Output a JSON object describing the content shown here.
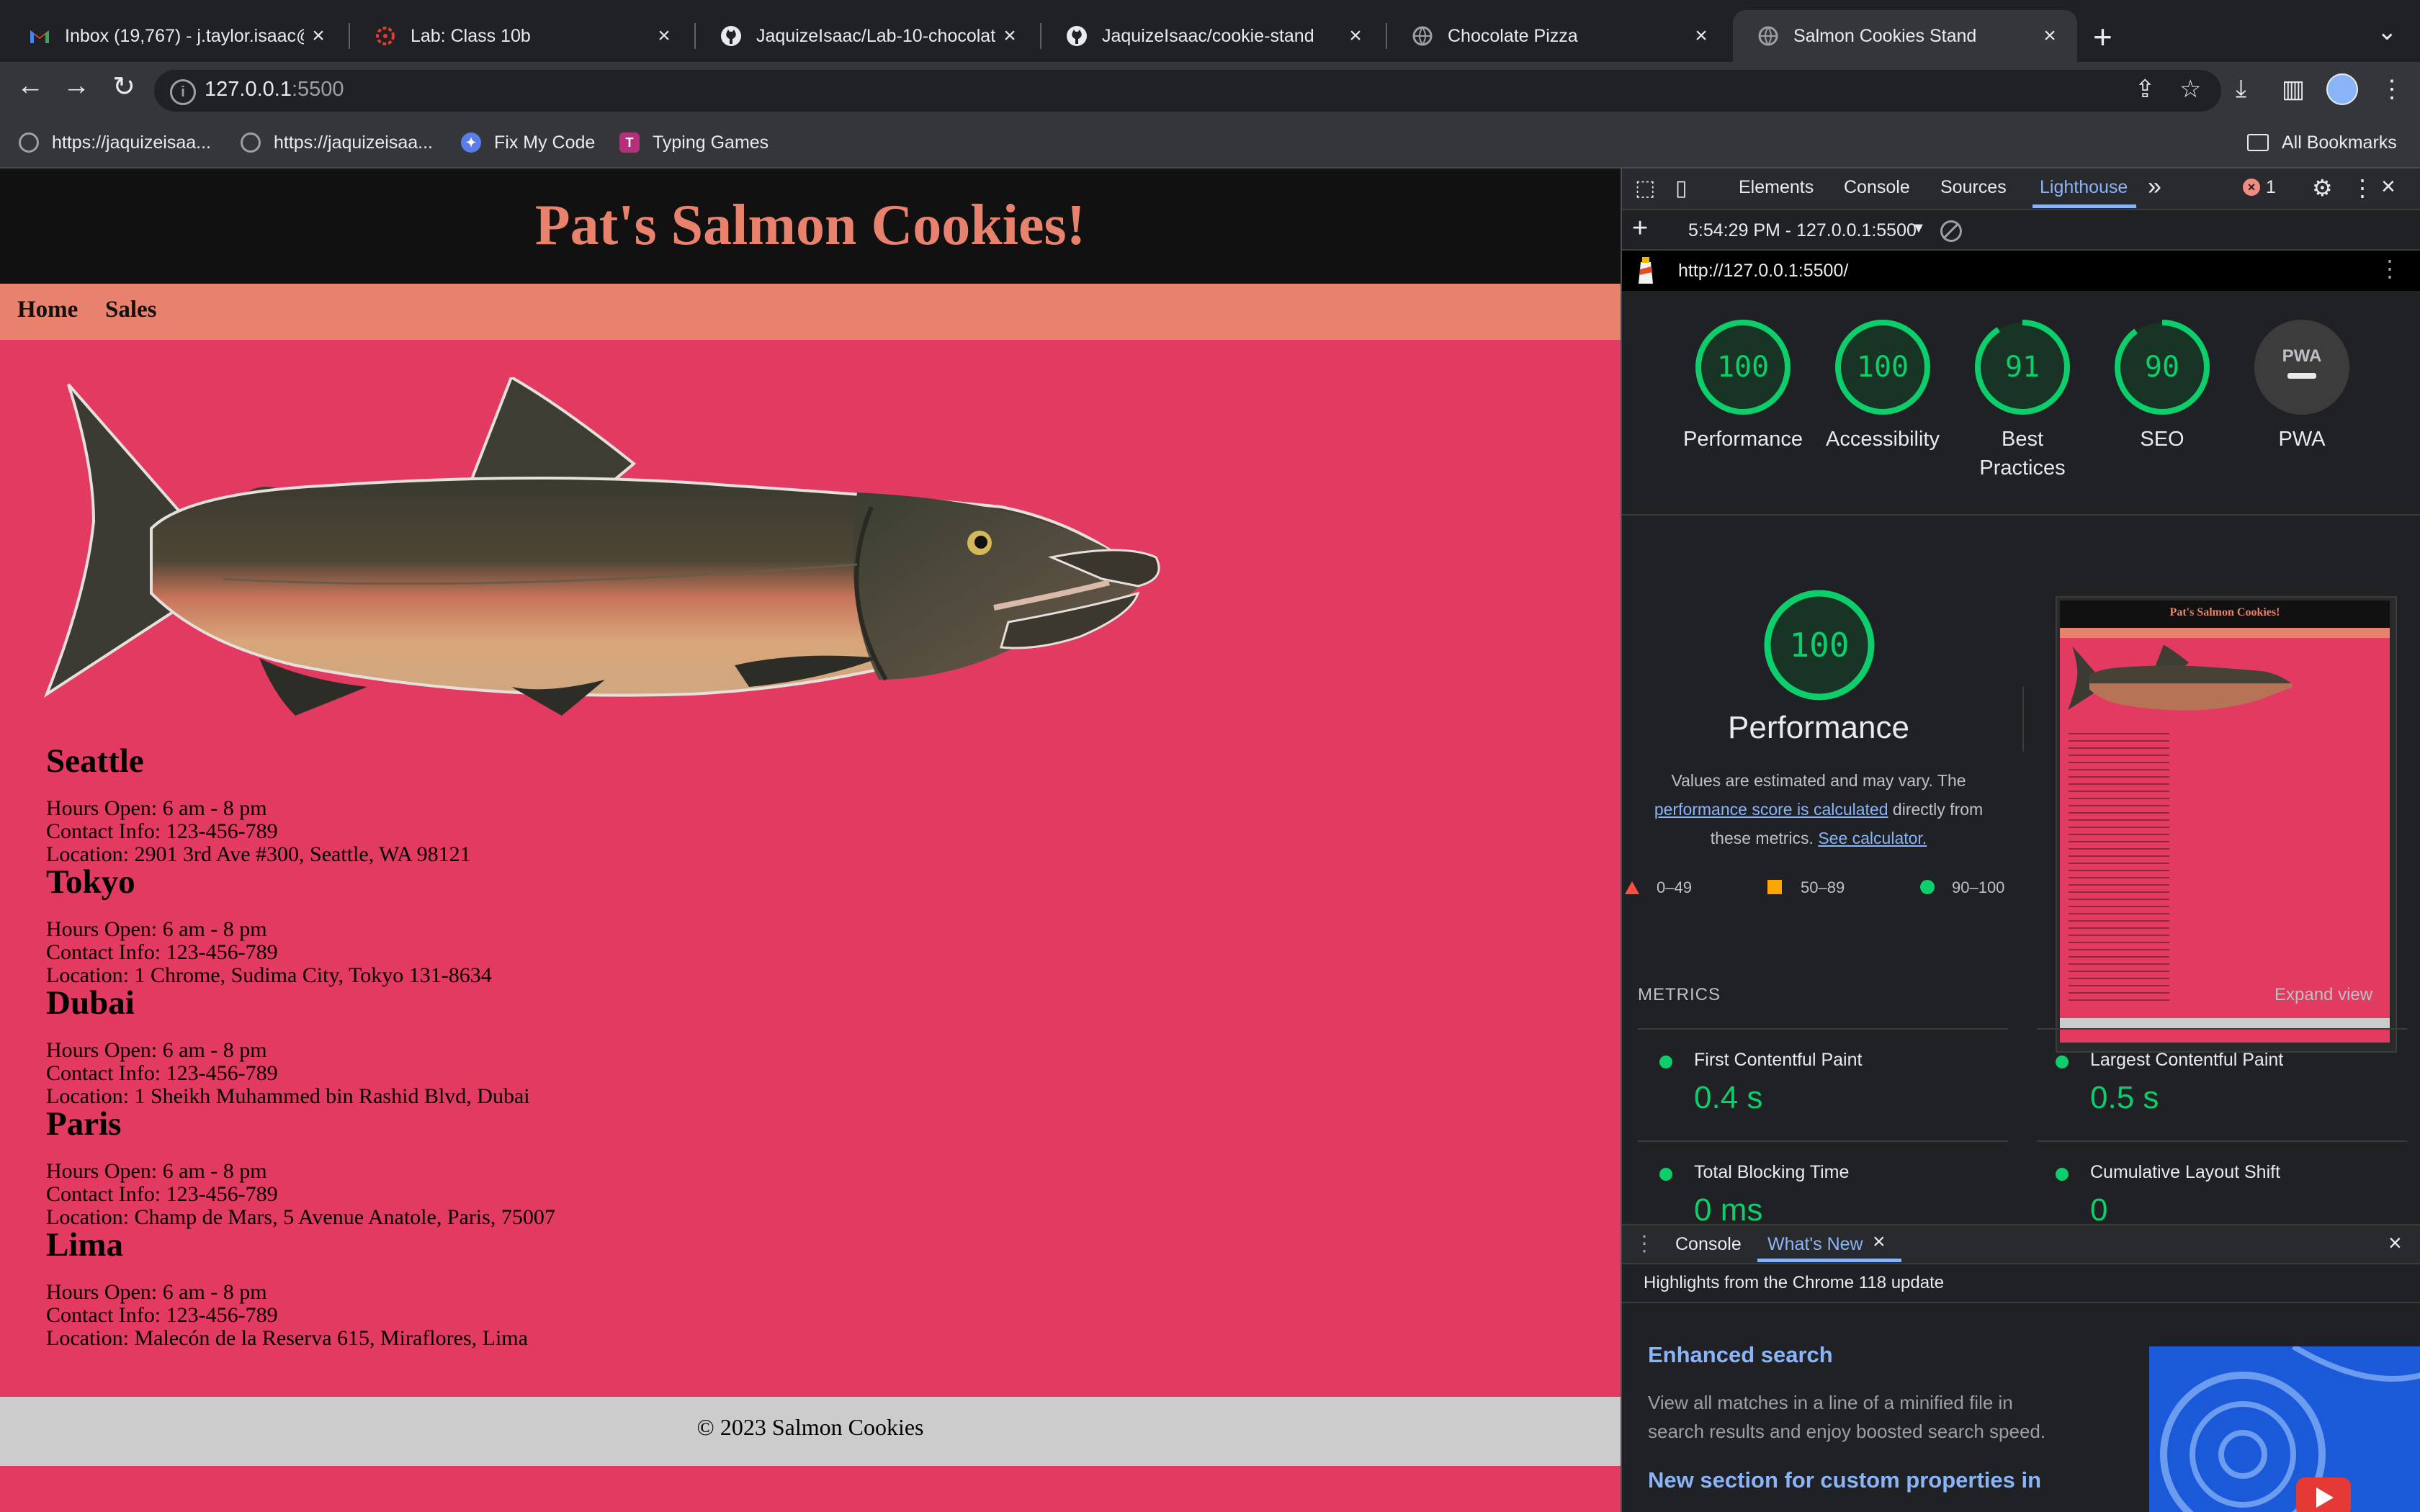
{
  "browser": {
    "tabs": [
      {
        "title": "Inbox (19,767) - j.taylor.isaac@",
        "icon": "gmail-icon",
        "active": false
      },
      {
        "title": "Lab: Class 10b",
        "icon": "canvas-icon",
        "active": false
      },
      {
        "title": "JaquizeIsaac/Lab-10-chocolat",
        "icon": "github-icon",
        "active": false
      },
      {
        "title": "JaquizeIsaac/cookie-stand",
        "icon": "github-icon",
        "active": false
      },
      {
        "title": "Chocolate Pizza",
        "icon": "globe-icon",
        "active": false
      },
      {
        "title": "Salmon Cookies Stand",
        "icon": "globe-icon",
        "active": true
      }
    ],
    "new_tab": "+",
    "url_host": "127.0.0.1",
    "url_port": ":5500",
    "bookmarks": [
      {
        "label": "https://jaquizeisaa...",
        "icon": "globe-icon"
      },
      {
        "label": "https://jaquizeisaa...",
        "icon": "globe-icon"
      },
      {
        "label": "Fix My Code",
        "icon": "fixmycode-icon"
      },
      {
        "label": "Typing Games",
        "icon": "typing-icon"
      }
    ],
    "all_bookmarks": "All Bookmarks"
  },
  "page": {
    "title": "Pat's Salmon Cookies!",
    "nav": [
      "Home",
      "Sales"
    ],
    "cities": [
      {
        "name": "Seattle",
        "hours": "Hours Open: 6 am - 8 pm",
        "contact": "Contact Info: 123-456-789",
        "location": "Location: 2901 3rd Ave #300, Seattle, WA 98121"
      },
      {
        "name": "Tokyo",
        "hours": "Hours Open: 6 am - 8 pm",
        "contact": "Contact Info: 123-456-789",
        "location": "Location: 1 Chrome, Sudima City, Tokyo 131-8634"
      },
      {
        "name": "Dubai",
        "hours": "Hours Open: 6 am - 8 pm",
        "contact": "Contact Info: 123-456-789",
        "location": "Location: 1 Sheikh Muhammed bin Rashid Blvd, Dubai"
      },
      {
        "name": "Paris",
        "hours": "Hours Open: 6 am - 8 pm",
        "contact": "Contact Info: 123-456-789",
        "location": "Location: Champ de Mars, 5 Avenue Anatole, Paris, 75007"
      },
      {
        "name": "Lima",
        "hours": "Hours Open: 6 am - 8 pm",
        "contact": "Contact Info: 123-456-789",
        "location": "Location: Malecón de la Reserva 615, Miraflores, Lima"
      }
    ],
    "footer": "© 2023 Salmon Cookies",
    "colors": {
      "background": "#e23a60",
      "header": "#111111",
      "nav": "#e8826d",
      "title": "#e8826d",
      "footer": "#cccccc"
    }
  },
  "devtools": {
    "tabs": [
      "Elements",
      "Console",
      "Sources",
      "Lighthouse"
    ],
    "active_tab": "Lighthouse",
    "more_tabs": "»",
    "error_count": "1",
    "report_selector": "5:54:29 PM - 127.0.0.1:5500",
    "report_url": "http://127.0.0.1:5500/",
    "scores": [
      {
        "label": "Performance",
        "value": "100",
        "fraction": 1.0
      },
      {
        "label": "Accessibility",
        "value": "100",
        "fraction": 1.0
      },
      {
        "label": "Best",
        "label2": "Practices",
        "value": "91",
        "fraction": 0.91
      },
      {
        "label": "SEO",
        "value": "90",
        "fraction": 0.9
      },
      {
        "label": "PWA",
        "value": "PWA",
        "fraction": 0
      }
    ],
    "perf": {
      "value": "100",
      "title": "Performance",
      "desc_1": "Values are estimated and may vary. The",
      "desc_link": "performance score is calculated",
      "desc_2": " directly from",
      "desc_3": "these metrics.",
      "desc_calc": "See calculator."
    },
    "legend": [
      "0–49",
      "50–89",
      "90–100"
    ],
    "screenshot_title": "Pat's Salmon Cookies!",
    "metrics_heading": "METRICS",
    "expand_view": "Expand view",
    "metrics": [
      {
        "name": "First Contentful Paint",
        "value": "0.4 s"
      },
      {
        "name": "Largest Contentful Paint",
        "value": "0.5 s"
      },
      {
        "name": "Total Blocking Time",
        "value": "0 ms"
      },
      {
        "name": "Cumulative Layout Shift",
        "value": "0"
      }
    ],
    "drawer": {
      "tabs": [
        "Console",
        "What's New"
      ],
      "active_tab": "What's New",
      "highlights": "Highlights from the Chrome 118 update",
      "item1_title": "Enhanced search",
      "item1_desc_1": "View all matches in a line of a minified file in",
      "item1_desc_2": "search results and enjoy boosted search speed.",
      "item2_title": "New section for custom properties in"
    },
    "colors": {
      "pass": "#0cce6b",
      "average": "#ffa400",
      "fail": "#ff4e42",
      "accent": "#8ab4f8"
    }
  }
}
